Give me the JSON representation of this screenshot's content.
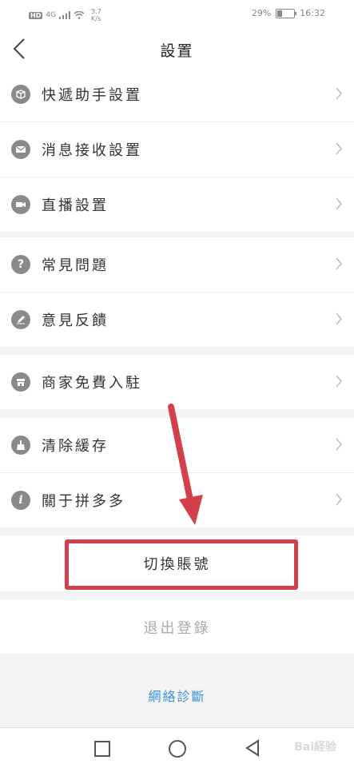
{
  "status_bar": {
    "hd": "HD",
    "signal": "4G",
    "speed_value": "3.7",
    "speed_unit": "K/s",
    "battery": "29%",
    "time": "16:32"
  },
  "header": {
    "title": "設置"
  },
  "groups": [
    {
      "items": [
        {
          "label": "快遞助手設置",
          "icon": "package-icon"
        },
        {
          "label": "消息接收設置",
          "icon": "mail-icon"
        },
        {
          "label": "直播設置",
          "icon": "video-icon"
        }
      ]
    },
    {
      "items": [
        {
          "label": "常見問題",
          "icon": "question-icon"
        },
        {
          "label": "意見反饋",
          "icon": "pencil-icon"
        }
      ]
    },
    {
      "items": [
        {
          "label": "商家免費入駐",
          "icon": "store-icon"
        }
      ]
    },
    {
      "items": [
        {
          "label": "清除緩存",
          "icon": "broom-icon"
        },
        {
          "label": "關于拼多多",
          "icon": "info-icon"
        }
      ]
    }
  ],
  "switch_account": "切換賬號",
  "logout": "退出登錄",
  "network_diagnosis": "網絡診斷",
  "watermark": "Bai経验",
  "accent_color": "#d43f4d",
  "link_color": "#3c8fd6"
}
